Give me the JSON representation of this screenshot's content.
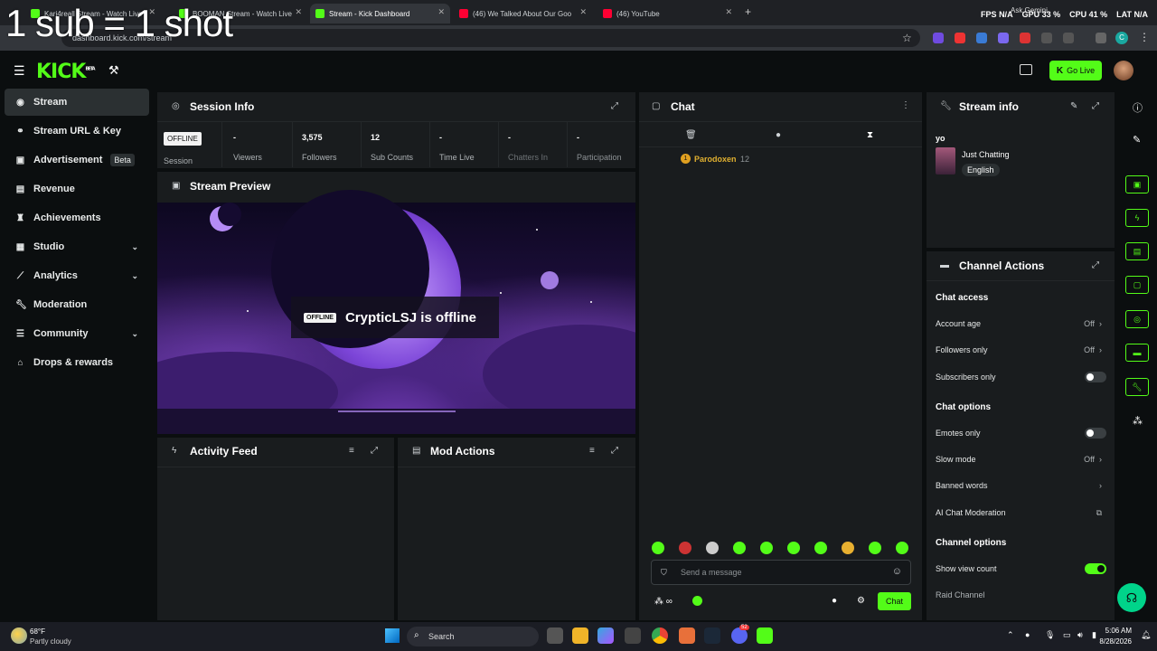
{
  "overlay_text": "1 sub = 1 shot",
  "browser": {
    "tabs": [
      {
        "title": "Kari4reall Stream - Watch Live",
        "fav": "#53fc18"
      },
      {
        "title": "BOOMAN Stream - Watch Live",
        "fav": "#53fc18"
      },
      {
        "title": "Stream - Kick Dashboard",
        "fav": "#53fc18"
      },
      {
        "title": "(46) We Talked About Our Goo",
        "fav": "#ff0033"
      },
      {
        "title": "(46) YouTube",
        "fav": "#ff0033"
      }
    ],
    "new_tab": "+",
    "url": "dashboard.kick.com/stream",
    "ask_gemini": "Ask Gemini",
    "perf": {
      "fps_label": "FPS",
      "fps": "N/A",
      "gpu_label": "GPU",
      "gpu": "33 %",
      "cpu_label": "CPU",
      "cpu": "41 %",
      "lat_label": "LAT",
      "lat": "N/A"
    },
    "profile_initial": "C"
  },
  "header": {
    "logo": "KICK",
    "logo_sup": "BETA",
    "go_live": "Go Live"
  },
  "sidebar": [
    {
      "label": "Stream",
      "icon": "broadcast-icon"
    },
    {
      "label": "Stream URL & Key",
      "icon": "link-icon"
    },
    {
      "label": "Advertisement",
      "icon": "ad-icon",
      "badge": "Beta"
    },
    {
      "label": "Revenue",
      "icon": "wallet-icon"
    },
    {
      "label": "Achievements",
      "icon": "trophy-icon"
    },
    {
      "label": "Studio",
      "icon": "layout-icon"
    },
    {
      "label": "Analytics",
      "icon": "chart-icon"
    },
    {
      "label": "Moderation",
      "icon": "wrench-icon"
    },
    {
      "label": "Community",
      "icon": "users-icon"
    },
    {
      "label": "Drops & rewards",
      "icon": "gift-icon"
    }
  ],
  "session": {
    "title": "Session Info",
    "status": "OFFLINE",
    "stats": [
      {
        "value": "",
        "label": "Session"
      },
      {
        "value": "-",
        "label": "Viewers"
      },
      {
        "value": "3,575",
        "label": "Followers"
      },
      {
        "value": "12",
        "label": "Sub Counts"
      },
      {
        "value": "-",
        "label": "Time Live"
      },
      {
        "value": "-",
        "label": "Chatters In"
      },
      {
        "value": "-",
        "label": "Participation"
      }
    ]
  },
  "preview": {
    "title": "Stream Preview",
    "badge": "OFFLINE",
    "message": "CrypticLSJ is offline"
  },
  "activity": {
    "title": "Activity Feed"
  },
  "mod_actions": {
    "title": "Mod Actions"
  },
  "chat": {
    "title": "Chat",
    "entry": {
      "user": "Parodoxen",
      "count": "12"
    },
    "placeholder": "Send a message",
    "send": "Chat"
  },
  "stream_info": {
    "title": "Stream info",
    "stream_title": "yo",
    "category": "Just Chatting",
    "language": "English"
  },
  "channel_actions": {
    "title": "Channel Actions",
    "chat_access": "Chat access",
    "account_age": {
      "label": "Account age",
      "value": "Off"
    },
    "followers_only": {
      "label": "Followers only",
      "value": "Off"
    },
    "subscribers_only": {
      "label": "Subscribers only"
    },
    "chat_options": "Chat options",
    "emotes_only": {
      "label": "Emotes only"
    },
    "slow_mode": {
      "label": "Slow mode",
      "value": "Off"
    },
    "banned_words": {
      "label": "Banned words"
    },
    "ai_moderation": {
      "label": "AI Chat Moderation"
    },
    "channel_options": "Channel options",
    "show_view_count": {
      "label": "Show view count"
    },
    "raid_channel": {
      "label": "Raid Channel"
    }
  },
  "taskbar": {
    "weather_temp": "68°F",
    "weather_desc": "Partly cloudy",
    "search": "Search",
    "time": "5:06 AM",
    "date": "8/28/2026",
    "discord_badge": "52"
  },
  "colors": {
    "accent": "#53fc18",
    "panel": "#191c1e",
    "bg": "#0b0e0f"
  }
}
